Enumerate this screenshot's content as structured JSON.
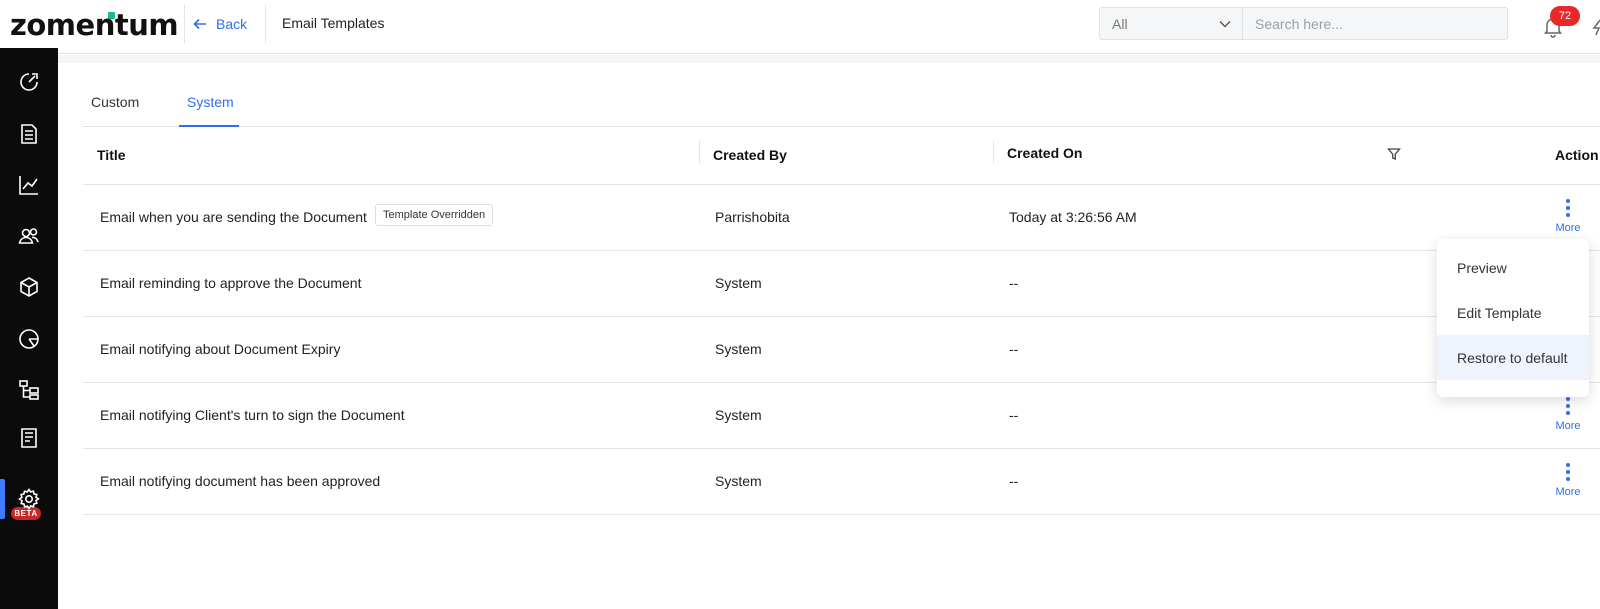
{
  "header": {
    "logo": "zomentum",
    "back_label": "Back",
    "page_title": "Email Templates",
    "filter_value": "All",
    "search_placeholder": "Search here...",
    "notification_count": "72"
  },
  "sidebar": {
    "items": [
      "dashboard-icon",
      "document-icon",
      "chart-icon",
      "users-icon",
      "box-icon",
      "pie-icon",
      "hierarchy-icon",
      "receipt-icon",
      "gear-icon"
    ],
    "beta_label": "BETA",
    "active": "gear-icon"
  },
  "tabs": [
    {
      "label": "Custom",
      "active": false
    },
    {
      "label": "System",
      "active": true
    }
  ],
  "table": {
    "headers": {
      "title": "Title",
      "created_by": "Created By",
      "created_on": "Created On",
      "action": "Action"
    },
    "more_label": "More",
    "rows": [
      {
        "title": "Email when you are sending the Document",
        "tag": "Template Overridden",
        "created_by": "Parrishobita",
        "created_on": "Today at 3:26:56 AM"
      },
      {
        "title": "Email reminding to approve the Document",
        "created_by": "System",
        "created_on": "--"
      },
      {
        "title": "Email notifying about Document Expiry",
        "created_by": "System",
        "created_on": "--"
      },
      {
        "title": "Email notifying Client's turn to sign the Document",
        "created_by": "System",
        "created_on": "--"
      },
      {
        "title": "Email notifying document has been approved",
        "created_by": "System",
        "created_on": "--"
      }
    ]
  },
  "dropdown_menu": {
    "items": [
      "Preview",
      "Edit Template",
      "Restore to default"
    ],
    "hovered": "Restore to default"
  },
  "colors": {
    "accent": "#2f6fed",
    "sidebar_bg": "#0b0b0b",
    "badge": "#e62a2a",
    "beta": "#c62828",
    "logo_dot": "#1eb59b"
  }
}
